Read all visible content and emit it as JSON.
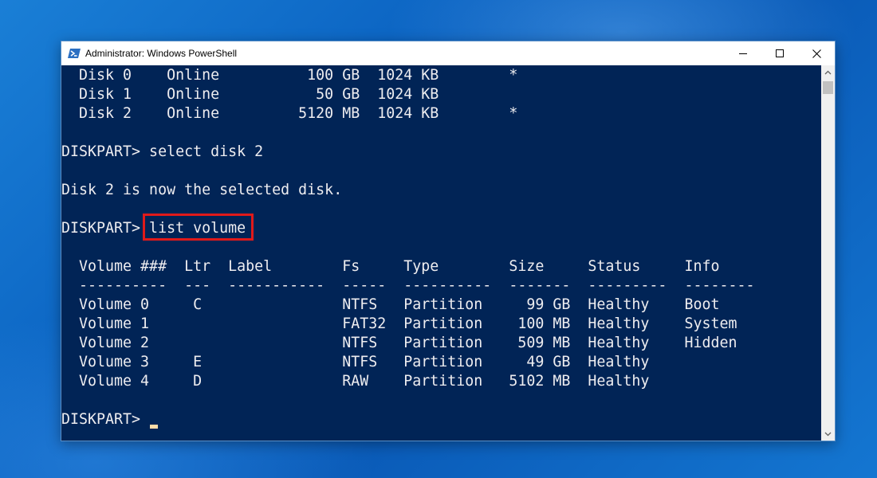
{
  "window": {
    "title": "Administrator: Windows PowerShell"
  },
  "console": {
    "lines": [
      "  Disk 0    Online          100 GB  1024 KB        *",
      "  Disk 1    Online           50 GB  1024 KB",
      "  Disk 2    Online         5120 MB  1024 KB        *",
      "",
      "DISKPART> select disk 2",
      "",
      "Disk 2 is now the selected disk.",
      "",
      "DISKPART> list volume",
      "",
      "  Volume ###  Ltr  Label        Fs     Type        Size     Status     Info",
      "  ----------  ---  -----------  -----  ----------  -------  ---------  --------",
      "  Volume 0     C                NTFS   Partition     99 GB  Healthy    Boot",
      "  Volume 1                      FAT32  Partition    100 MB  Healthy    System",
      "  Volume 2                      NTFS   Partition    509 MB  Healthy    Hidden",
      "  Volume 3     E                NTFS   Partition     49 GB  Healthy",
      "  Volume 4     D                RAW    Partition   5102 MB  Healthy",
      "",
      "DISKPART> "
    ],
    "highlighted_command": "list volume",
    "colors": {
      "background": "#012456",
      "text": "#eeedf0",
      "highlight_box": "#e01a1a",
      "cursor": "#fedba9"
    }
  },
  "icons": {
    "app": "powershell-icon",
    "minimize": "minimize-icon",
    "maximize": "maximize-icon",
    "close": "close-icon",
    "scroll_up": "chevron-up-icon",
    "scroll_down": "chevron-down-icon"
  }
}
